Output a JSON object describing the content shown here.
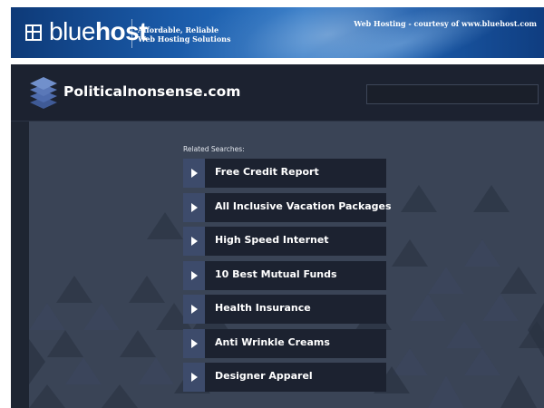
{
  "banner": {
    "logo_light": "blue",
    "logo_bold": "host",
    "tagline_line1": "Affordable, Reliable",
    "tagline_line2": "Web Hosting Solutions",
    "courtesy": "Web Hosting - courtesy of www.bluehost.com",
    "logo_icon": "grid-square-icon"
  },
  "site": {
    "title": "Politicalnonsense.com",
    "icon": "stacked-layers-icon"
  },
  "search": {
    "value": ""
  },
  "related": {
    "label": "Related Searches:",
    "links": [
      {
        "label": "Free Credit Report"
      },
      {
        "label": "All Inclusive Vacation Packages"
      },
      {
        "label": "High Speed Internet"
      },
      {
        "label": "10 Best Mutual Funds"
      },
      {
        "label": "Health Insurance"
      },
      {
        "label": "Anti Wrinkle Creams"
      },
      {
        "label": "Designer Apparel"
      }
    ]
  },
  "colors": {
    "banner_blue": "#1a5aa8",
    "page_dark": "#1e2532",
    "content_slate": "#3a4456",
    "link_bg": "#1c2230",
    "arrow_box": "#3d4b6b",
    "icon_blue": "#5a78b8"
  }
}
